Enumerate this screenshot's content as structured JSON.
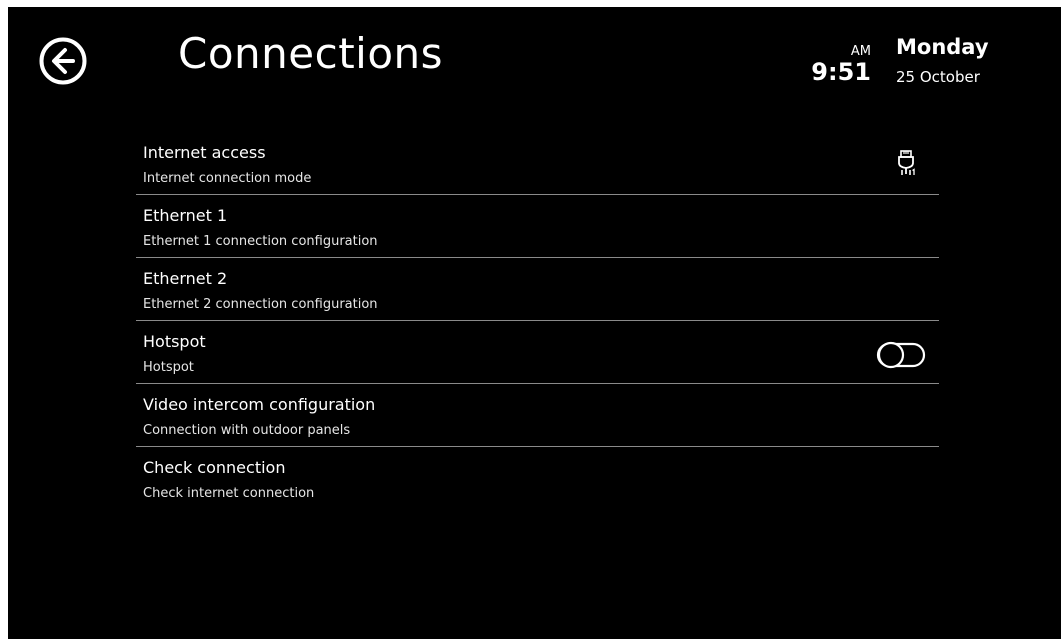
{
  "header": {
    "title": "Connections",
    "back_icon": "arrow-left-circle-icon",
    "clock": {
      "ampm": "AM",
      "time": "9:51",
      "day": "Monday",
      "date": "25 October"
    }
  },
  "items": [
    {
      "title": "Internet access",
      "subtitle": "Internet connection mode",
      "icon": "ethernet-port-1-icon"
    },
    {
      "title": "Ethernet 1",
      "subtitle": "Ethernet 1 connection configuration"
    },
    {
      "title": "Ethernet 2",
      "subtitle": "Ethernet 2 connection configuration"
    },
    {
      "title": "Hotspot",
      "subtitle": "Hotspot",
      "toggle": "off"
    },
    {
      "title": "Video intercom configuration",
      "subtitle": "Connection with outdoor panels"
    },
    {
      "title": "Check connection",
      "subtitle": "Check internet connection"
    }
  ],
  "colors": {
    "background": "#000000",
    "text": "#ffffff",
    "divider": "#8a8a8a"
  }
}
